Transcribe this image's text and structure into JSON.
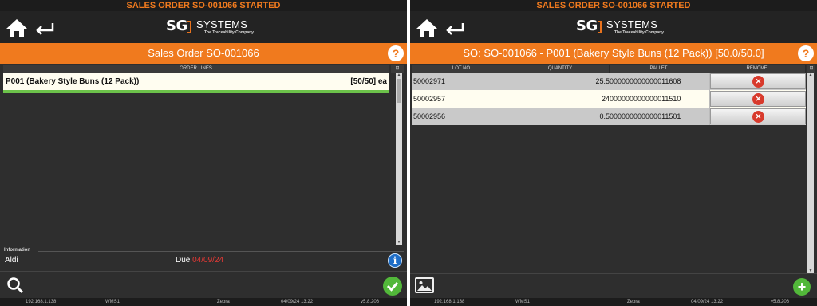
{
  "left": {
    "banner": "SALES ORDER SO-001066 STARTED",
    "logo": {
      "brand": "SG",
      "name": "SYSTEMS",
      "tagline": "The Traceability Company"
    },
    "title": "Sales Order SO-001066",
    "help": "?",
    "order_lines_header": "ORDER LINES",
    "order_line": {
      "code": "P001 (Bakery Style Buns (12 Pack))",
      "qty": "[50/50] ea",
      "progress": 1.0
    },
    "information_label": "Information",
    "customer": "Aldi",
    "due_label": "Due",
    "due_date": "04/09/24",
    "info_glyph": "i",
    "status": {
      "ip": "192.168.1.138",
      "site": "WMS1",
      "printer": "Zebra",
      "datetime": "04/09/24 13:22",
      "version": "v5.8.206"
    }
  },
  "right": {
    "banner": "SALES ORDER SO-001066 STARTED",
    "logo": {
      "brand": "SG",
      "name": "SYSTEMS",
      "tagline": "The Traceability Company"
    },
    "title": "SO: SO-001066 - P001 (Bakery Style Buns (12 Pack)) [50.0/50.0]",
    "help": "?",
    "columns": [
      "LOT NO",
      "QUANTITY",
      "PALLET",
      "REMOVE"
    ],
    "rows": [
      {
        "lot": "50002971",
        "qty": "25.5",
        "pallet": "000000000000011608"
      },
      {
        "lot": "50002957",
        "qty": "24",
        "pallet": "000000000000011510"
      },
      {
        "lot": "50002956",
        "qty": "0.5",
        "pallet": "000000000000011501"
      }
    ],
    "remove_glyph": "✕",
    "add_glyph": "+",
    "status": {
      "ip": "192.168.1.138",
      "site": "WMS1",
      "printer": "Zebra",
      "datetime": "04/09/24 13:22",
      "version": "v5.8.206"
    }
  },
  "colors": {
    "accent": "#f07a1e",
    "dark": "#2e2e2e",
    "ok": "#52b83a",
    "remove": "#d83a2c",
    "due": "#e53935"
  },
  "icons": [
    "home-icon",
    "back-arrow-icon",
    "help-icon",
    "info-icon",
    "search-icon",
    "check-icon",
    "image-icon",
    "plus-icon",
    "remove-icon"
  ]
}
